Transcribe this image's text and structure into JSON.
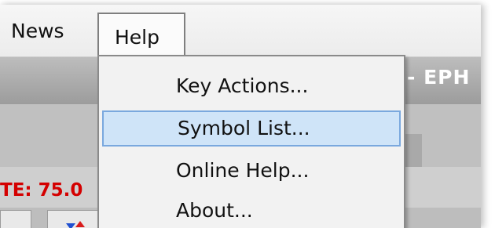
{
  "menubar": {
    "items": [
      {
        "label": "News"
      },
      {
        "label": "Help"
      }
    ]
  },
  "window": {
    "title_fragment": "- EPH",
    "rate_fragment": "TE: 75.0"
  },
  "help_menu": {
    "items": [
      {
        "label": "Key Actions..."
      },
      {
        "label": "Symbol List...",
        "highlighted": true
      },
      {
        "label": "Online Help..."
      },
      {
        "label": "About..."
      }
    ]
  },
  "colors": {
    "highlight_fill": "#cfe4f8",
    "highlight_border": "#7aa8de",
    "rate_text": "#d40000"
  }
}
